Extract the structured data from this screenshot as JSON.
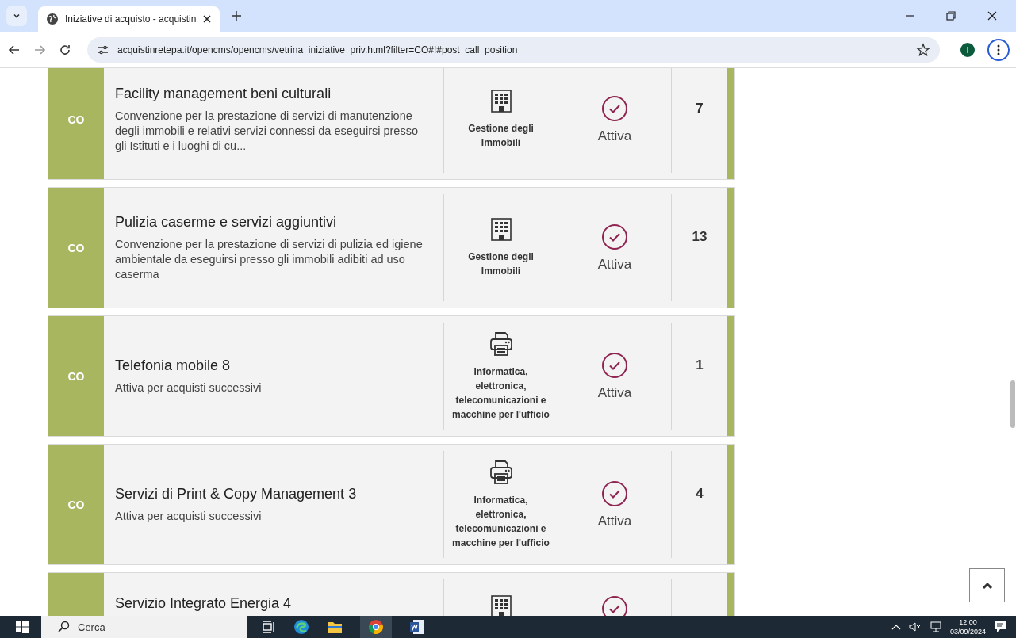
{
  "browser": {
    "tab_title": "Iniziative di acquisto - acquistin",
    "url": "acquistinretepa.it/opencms/opencms/vetrina_iniziative_priv.html?filter=CO#!#post_call_position",
    "profile_initial": "I"
  },
  "cards": [
    {
      "code": "CO",
      "title": "Facility management beni culturali",
      "description": "Convenzione per la prestazione di servizi di manutenzione degli immobili e relativi servizi connessi da eseguirsi presso gli Istituti e i luoghi di cu...",
      "kind": "building",
      "category": "Gestione degli Immobili",
      "status": "Attiva",
      "count": "7"
    },
    {
      "code": "CO",
      "title": "Pulizia caserme e servizi aggiuntivi",
      "description": "Convenzione per la prestazione di servizi di pulizia ed igiene ambientale da eseguirsi presso gli immobili adibiti ad uso caserma",
      "kind": "building",
      "category": "Gestione degli Immobili",
      "status": "Attiva",
      "count": "13"
    },
    {
      "code": "CO",
      "title": "Telefonia mobile 8",
      "description": "Attiva per acquisti successivi",
      "kind": "printer",
      "category": "Informatica, elettronica, telecomunicazioni e macchine per l'ufficio",
      "status": "Attiva",
      "count": "1"
    },
    {
      "code": "CO",
      "title": "Servizi di Print & Copy Management 3",
      "description": "Attiva per acquisti successivi",
      "kind": "printer",
      "category": "Informatica, elettronica, telecomunicazioni e macchine per l'ufficio",
      "status": "Attiva",
      "count": "4"
    },
    {
      "title": "Servizio Integrato Energia 4",
      "kind": "building"
    }
  ],
  "taskbar": {
    "search_placeholder": "Cerca",
    "time": "12:00",
    "date": "03/09/2024"
  }
}
